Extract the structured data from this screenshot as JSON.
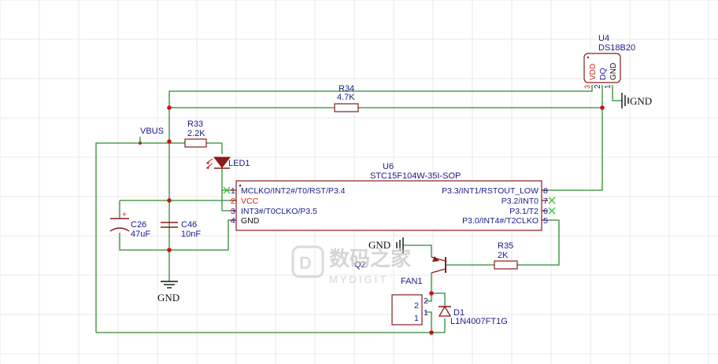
{
  "labels": {
    "vbus": "VBUS",
    "gnd": "GND",
    "r33_ref": "R33",
    "r33_val": "2.2K",
    "r34_ref": "R34",
    "r34_val": "4.7K",
    "r35_ref": "R35",
    "r35_val": "2K",
    "led_ref": "LED1",
    "c26_ref": "C26",
    "c26_val": "47uF",
    "c46_ref": "C46",
    "c46_val": "10nF",
    "u4_ref": "U4",
    "u4_val": "DS18B20",
    "u6_ref": "U6",
    "u6_val": "STC15F104W-35I-SOP",
    "q2_ref": "Q2",
    "fan_ref": "FAN1",
    "d1_ref": "D1",
    "d1_val": "L1N4007FT1G",
    "plus": "+"
  },
  "u4_pins": {
    "vdd": "VDD",
    "dq": "DQ",
    "gnd": "GND",
    "n3": "3",
    "n2": "2",
    "n1": "1"
  },
  "u6_pins_left": [
    {
      "num": "1",
      "name": "MCLKO/INT2#/T0/RST/P3.4"
    },
    {
      "num": "2",
      "name": "VCC"
    },
    {
      "num": "3",
      "name": "INT3#/T0CLKO/P3.5"
    },
    {
      "num": "4",
      "name": "GND"
    }
  ],
  "u6_pins_right": [
    {
      "num": "8",
      "name": "P3.3/INT1/RSTOUT_LOW"
    },
    {
      "num": "7",
      "name": "P3.2/INT0"
    },
    {
      "num": "6",
      "name": "P3.1/T2"
    },
    {
      "num": "5",
      "name": "P3.0/INT4#/T2CLKO"
    }
  ],
  "fan_pins": {
    "p2": "2",
    "p1": "1"
  },
  "watermark": {
    "cn": "数码之家",
    "en": "MYDIGIT"
  },
  "colors": {
    "wire": "#2e8b2e",
    "component": "#8b1a1a",
    "text": "#1a1a8c",
    "junction": "#cc1111",
    "noconnect": "#33cc33"
  }
}
